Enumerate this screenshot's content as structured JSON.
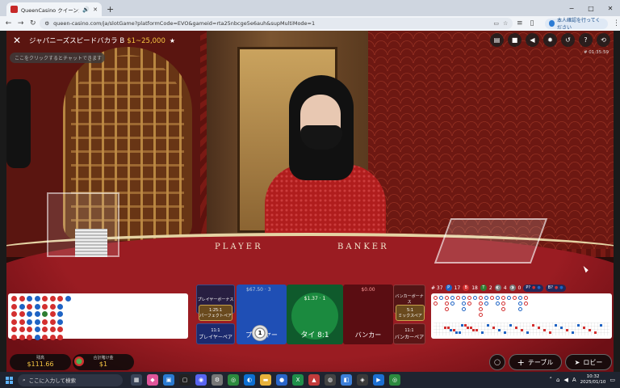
{
  "browser": {
    "tab_title": "QueenCasino クイーンカジノ",
    "url": "queen-casino.com/ja/slotGame?platformCode=EVO&gameid=rta25nbcge5e6auh&supMultiMode=1",
    "profile_label": "本人確認を行ってください",
    "window_controls": [
      "−",
      "□",
      "✕"
    ]
  },
  "game": {
    "title": "ジャパニーズスピードバカラ B",
    "limits": "$1~25,000",
    "game_id": "# 01:35:59",
    "chat_placeholder": "ここをクリックするとチャットできます",
    "table_labels": {
      "player": "PLAYER",
      "banker": "BANKER"
    },
    "hud_icons": [
      "chat-icon",
      "video-icon",
      "volume-icon",
      "settings-icon",
      "history-icon",
      "help-icon",
      "fullscreen-icon"
    ]
  },
  "stats": {
    "total": "# 37",
    "player": "17",
    "banker": "18",
    "tie": "2",
    "player_pair_count": "4",
    "banker_pair_count": "0",
    "p_label": "P?",
    "b_label": "B?"
  },
  "bead_road": [
    "B",
    "B",
    "B",
    "B",
    "B",
    "B",
    "B",
    "P",
    "B",
    "B",
    "B",
    "B",
    "P",
    "B",
    "P",
    "P",
    "B",
    "B",
    "P",
    "P",
    "P",
    "P",
    "P",
    "P",
    "B",
    "B",
    "T",
    "B",
    "B",
    "B",
    "B",
    "B",
    "B",
    "B",
    "B",
    "B",
    "B",
    "P",
    "P",
    "P",
    "B",
    "B",
    "P",
    "E",
    "E",
    "E",
    "E",
    "E"
  ],
  "big_road": [
    "B",
    "B",
    "E",
    "E",
    "E",
    "E",
    "P",
    "E",
    "E",
    "E",
    "E",
    "E",
    "B",
    "B",
    "B",
    "E",
    "E",
    "E",
    "P",
    "P",
    "E",
    "E",
    "E",
    "E",
    "B",
    "E",
    "E",
    "E",
    "E",
    "E",
    "P",
    "P",
    "P",
    "E",
    "E",
    "E",
    "B",
    "B",
    "E",
    "E",
    "E",
    "E",
    "P",
    "E",
    "E",
    "E",
    "E",
    "E",
    "B",
    "B",
    "B",
    "B",
    "E",
    "E",
    "P",
    "P",
    "E",
    "E",
    "E",
    "E",
    "B",
    "E",
    "E",
    "E",
    "E",
    "E",
    "P",
    "P",
    "E",
    "E",
    "E",
    "E",
    "B",
    "B",
    "B",
    "E",
    "E",
    "E",
    "P",
    "E",
    "E",
    "E",
    "E",
    "E",
    "B",
    "E",
    "E",
    "E",
    "E",
    "E",
    "P",
    "P",
    "P",
    "E",
    "E",
    "E",
    "B",
    "B",
    "E",
    "E",
    "E",
    "E",
    "E",
    "E",
    "E",
    "E",
    "E",
    "E",
    "E",
    "E",
    "E",
    "E",
    "E",
    "E",
    "E",
    "E",
    "E",
    "E",
    "E",
    "E"
  ],
  "bets": {
    "player_bonus": "プレイヤーボーナス",
    "player_perfect_odds": "1:25:1",
    "player_perfect": "パーフェクトペア",
    "player_pair_odds": "11:1",
    "player_pair": "プレイヤーペア",
    "player_amount": "$67.50",
    "player_count": "3",
    "player": "プレイヤー",
    "tie_amount": "$1.37",
    "tie_count": "1",
    "tie": "タイ 8:1",
    "banker_amount": "$0.00",
    "banker": "バンカー",
    "banker_bonus": "バンカーボーナス",
    "banker_super_odds": "5:1",
    "banker_super": "ミックスペア",
    "banker_pair_odds": "11:1",
    "banker_pair": "バンカーペア",
    "chip_value": "1"
  },
  "footer": {
    "balance_label": "残高",
    "balance": "$111.66",
    "total_bet_label": "合計賭け金",
    "total_bet": "$1",
    "table_button": "テーブル",
    "lobby_button": "ロビー"
  },
  "taskbar": {
    "search_placeholder": "ここに入力して検索",
    "time": "10:32",
    "date": "2025/01/10",
    "ime": "A"
  },
  "colors": {
    "banker": "#d32f2f",
    "player": "#1e63c4",
    "tie": "#2e7d32",
    "gold": "#f5c542"
  }
}
